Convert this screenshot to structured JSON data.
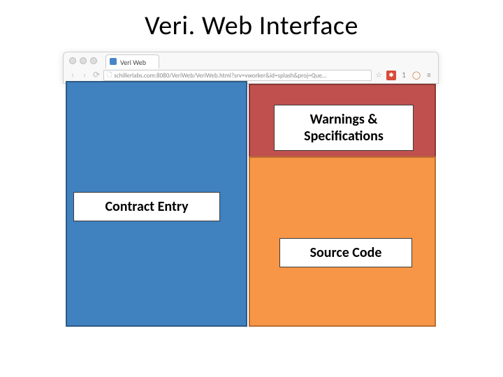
{
  "title": "Veri. Web Interface",
  "browser": {
    "tab_title": "Veri Web",
    "url": "schillerlabs.com:8080/VeriWeb/VeriWeb.html?srv=vworker&id=splash&proj=Que…"
  },
  "panels": {
    "left_label": "Contract Entry",
    "topright_label": "Warnings & Specifications",
    "bottomright_label": "Source Code"
  },
  "icons": {
    "back": "‹",
    "forward": "›",
    "reload": "⟳",
    "page": "🗋",
    "star": "☆",
    "block": "✱",
    "one": "1",
    "shield": "◯",
    "menu": "≡"
  }
}
